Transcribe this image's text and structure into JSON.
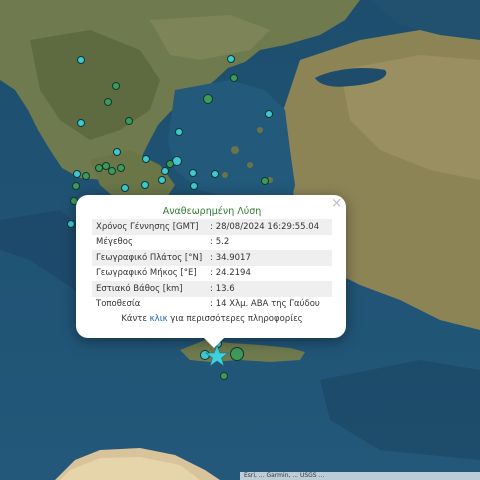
{
  "popup": {
    "title": "Αναθεωρημένη Λύση",
    "close_glyph": "×",
    "rows": [
      {
        "label": "Χρόνος Γέννησης [GMT]",
        "value": ": 28/08/2024 16:29:55.04"
      },
      {
        "label": "Μέγεθος",
        "value": ": 5.2"
      },
      {
        "label": "Γεωγραφικό Πλάτος [°N]",
        "value": ": 34.9017"
      },
      {
        "label": "Γεωγραφικό Μήκος [°E]",
        "value": ": 24.2194"
      },
      {
        "label": "Εστιακό Βάθος [km]",
        "value": ": 13.6"
      },
      {
        "label": "Τοποθεσία",
        "value": ": 14 Χλμ. ΑΒΑ της Γαύδου"
      }
    ],
    "more_prefix": "Κάντε ",
    "more_link": "κλικ",
    "more_suffix": " για περισσότερες πληροφορίες"
  },
  "attribution": "Esri, ... Garmin, ... USGS ...",
  "markers": {
    "colors": {
      "cyan": "#40c7d3",
      "green": "#3f9a5a"
    },
    "main_event_icon": "star-icon",
    "main_event_color": "#3fd0e0"
  }
}
